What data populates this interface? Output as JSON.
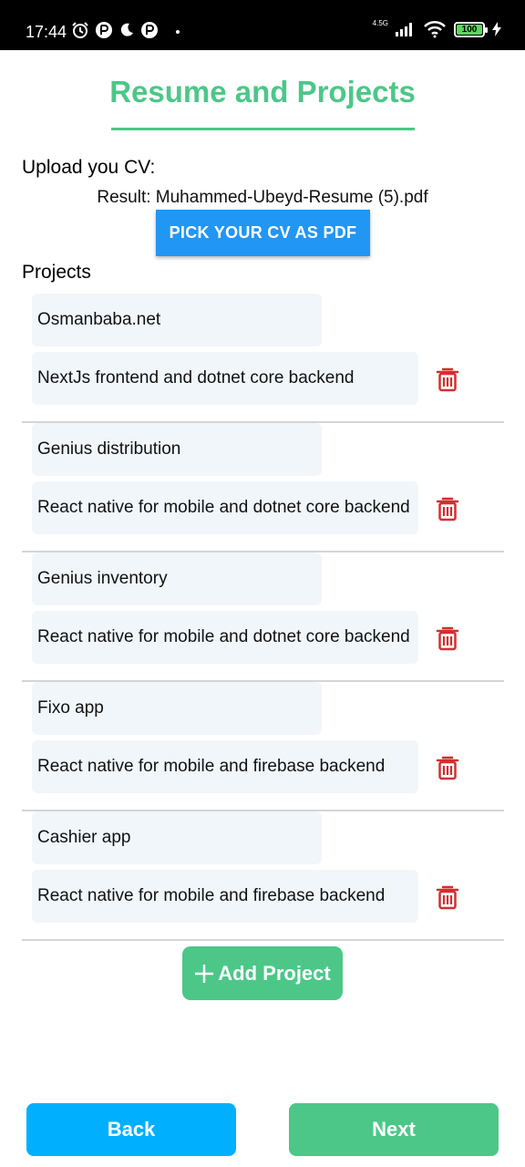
{
  "status_bar": {
    "time": "17:44",
    "network_type": "4.5G",
    "battery_level": "100"
  },
  "header": {
    "title": "Resume and Projects"
  },
  "upload": {
    "label": "Upload you CV:",
    "result_text": "Result: Muhammed-Ubeyd-Resume (5).pdf",
    "pick_button_label": "PICK YOUR CV AS PDF"
  },
  "projects": {
    "label": "Projects",
    "items": [
      {
        "name": "Osmanbaba.net",
        "description": "NextJs frontend and dotnet core backend"
      },
      {
        "name": "Genius distribution",
        "description": "React native for mobile and dotnet core backend"
      },
      {
        "name": "Genius inventory",
        "description": "React native for mobile and dotnet core backend"
      },
      {
        "name": "Fixo app",
        "description": "React native for mobile and firebase backend"
      },
      {
        "name": "Cashier app",
        "description": "React native for mobile and firebase backend"
      }
    ],
    "add_button_label": "Add Project"
  },
  "footer": {
    "back_label": "Back",
    "next_label": "Next"
  },
  "colors": {
    "accent_green": "#4cc788",
    "pick_blue": "#2196f3",
    "back_blue": "#00b0ff",
    "trash_red": "#d32f2f",
    "input_bg": "#f1f6fb"
  },
  "icons": {
    "delete": "trash-icon",
    "add": "plus-icon"
  }
}
